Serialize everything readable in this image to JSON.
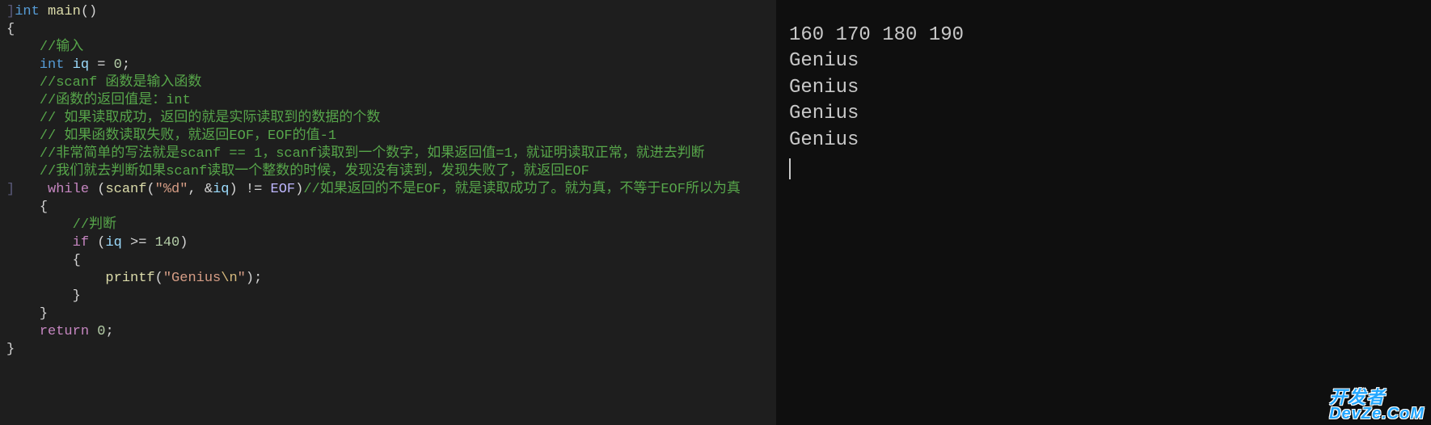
{
  "editor": {
    "code_lines": [
      {
        "indent": 0,
        "tokens": [
          [
            "bracket",
            "]"
          ],
          [
            "type",
            "int "
          ],
          [
            "func",
            "main"
          ],
          [
            "paren",
            "()"
          ]
        ]
      },
      {
        "indent": 0,
        "tokens": [
          [
            "brace",
            "{"
          ]
        ]
      },
      {
        "indent": 0,
        "tokens": []
      },
      {
        "indent": 1,
        "tokens": [
          [
            "comment",
            "//输入"
          ]
        ]
      },
      {
        "indent": 1,
        "tokens": [
          [
            "type",
            "int "
          ],
          [
            "ident",
            "iq"
          ],
          [
            "op",
            " = "
          ],
          [
            "number",
            "0"
          ],
          [
            "plain",
            ";"
          ]
        ]
      },
      {
        "indent": 1,
        "tokens": [
          [
            "comment",
            "//scanf 函数是输入函数"
          ]
        ]
      },
      {
        "indent": 1,
        "tokens": [
          [
            "comment",
            "//函数的返回值是：int"
          ]
        ]
      },
      {
        "indent": 1,
        "tokens": [
          [
            "comment",
            "// 如果读取成功，返回的就是实际读取到的数据的个数"
          ]
        ]
      },
      {
        "indent": 1,
        "tokens": [
          [
            "comment",
            "// 如果函数读取失败，就返回EOF，EOF的值-1"
          ]
        ]
      },
      {
        "indent": 1,
        "tokens": [
          [
            "comment",
            "//非常简单的写法就是scanf == 1，scanf读取到一个数字，如果返回值=1，就证明读取正常，就进去判断"
          ]
        ]
      },
      {
        "indent": 1,
        "tokens": [
          [
            "comment",
            "//我们就去判断如果scanf读取一个整数的时候，发现没有读到，发现失败了，就返回EOF"
          ]
        ]
      },
      {
        "indent": 1,
        "tokens": [
          [
            "bracket",
            "]"
          ],
          [
            "kw",
            "while "
          ],
          [
            "paren",
            "("
          ],
          [
            "func",
            "scanf"
          ],
          [
            "paren",
            "("
          ],
          [
            "string",
            "\"%d\""
          ],
          [
            "plain",
            ", "
          ],
          [
            "op",
            "&"
          ],
          [
            "ident",
            "iq"
          ],
          [
            "paren",
            ")"
          ],
          [
            "op",
            " != "
          ],
          [
            "macro",
            "EOF"
          ],
          [
            "paren",
            ")"
          ],
          [
            "comment",
            "//如果返回的不是EOF，就是读取成功了。就为真，不等于EOF所以为真"
          ]
        ]
      },
      {
        "indent": 1,
        "tokens": [
          [
            "brace",
            "{"
          ]
        ]
      },
      {
        "indent": 2,
        "tokens": [
          [
            "comment",
            "//判断"
          ]
        ]
      },
      {
        "indent": 2,
        "tokens": [
          [
            "kw",
            "if "
          ],
          [
            "paren",
            "("
          ],
          [
            "ident",
            "iq"
          ],
          [
            "op",
            " >= "
          ],
          [
            "number",
            "140"
          ],
          [
            "paren",
            ")"
          ]
        ]
      },
      {
        "indent": 2,
        "tokens": [
          [
            "brace",
            "{"
          ]
        ]
      },
      {
        "indent": 3,
        "tokens": [
          [
            "func",
            "printf"
          ],
          [
            "paren",
            "("
          ],
          [
            "string",
            "\"Genius"
          ],
          [
            "esc",
            "\\n"
          ],
          [
            "string",
            "\""
          ],
          [
            "paren",
            ")"
          ],
          [
            "plain",
            ";"
          ]
        ]
      },
      {
        "indent": 2,
        "tokens": [
          [
            "brace",
            "}"
          ]
        ]
      },
      {
        "indent": 1,
        "tokens": [
          [
            "brace",
            "}"
          ]
        ]
      },
      {
        "indent": 1,
        "tokens": [
          [
            "kw",
            "return "
          ],
          [
            "number",
            "0"
          ],
          [
            "plain",
            ";"
          ]
        ]
      },
      {
        "indent": 0,
        "tokens": [
          [
            "brace",
            "}"
          ]
        ]
      }
    ]
  },
  "terminal": {
    "lines": [
      "160 170 180 190",
      "Genius",
      "Genius",
      "Genius",
      "Genius"
    ]
  },
  "watermark": {
    "line1": "开发者",
    "line2": "DevZe.CoM"
  }
}
